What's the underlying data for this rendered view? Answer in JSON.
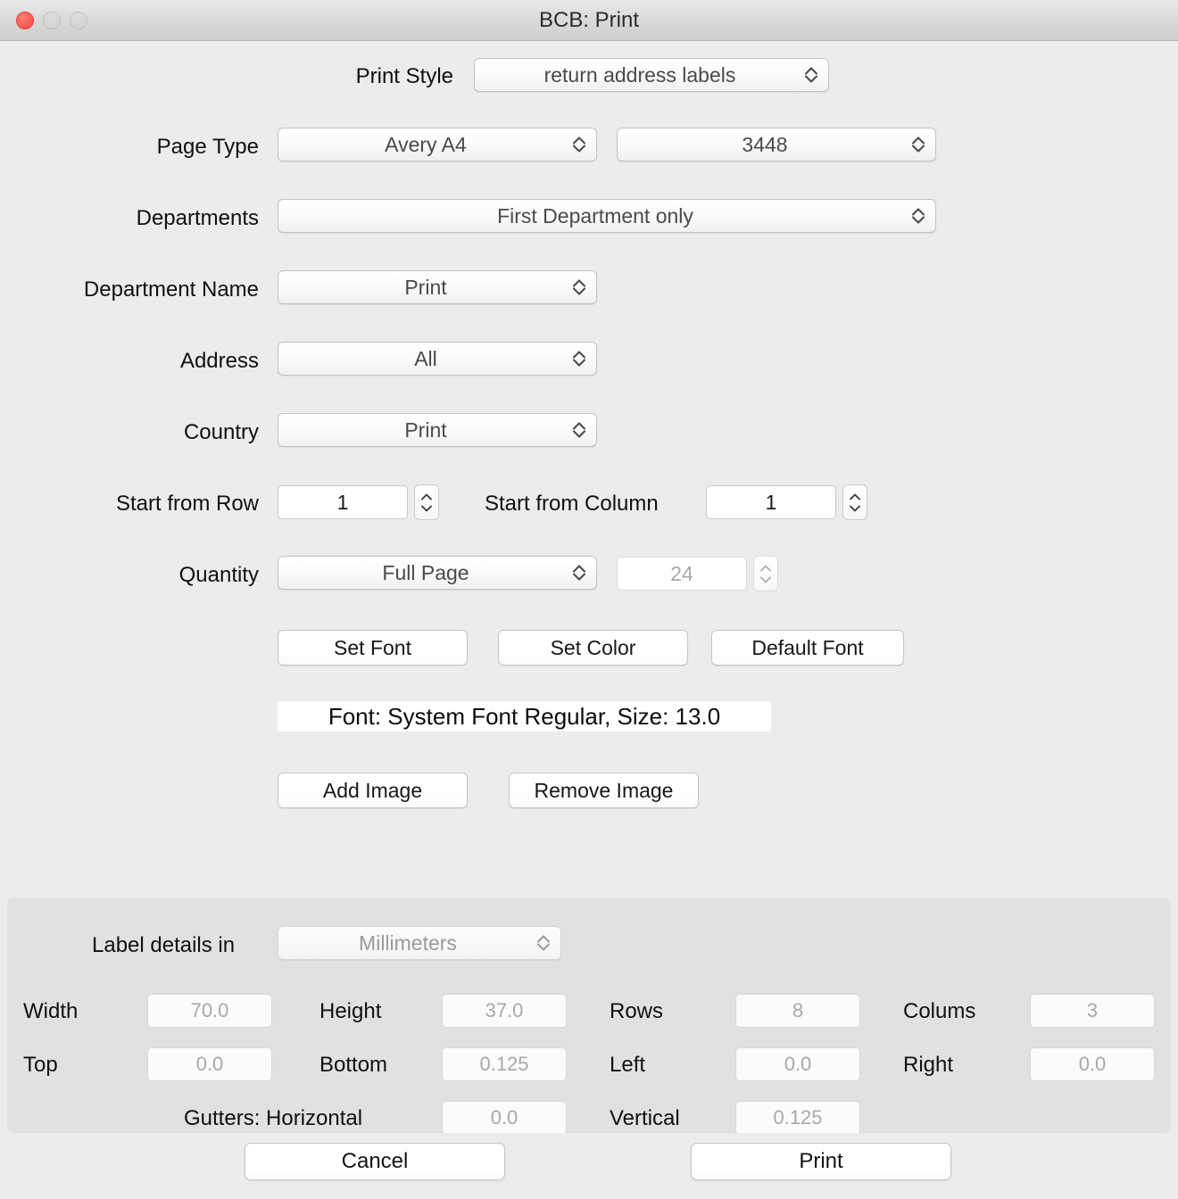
{
  "window": {
    "title": "BCB: Print",
    "close_label": "close",
    "minimize_label": "minimize",
    "zoom_label": "zoom"
  },
  "form": {
    "print_style": {
      "label": "Print Style",
      "value": "return address labels"
    },
    "page_type": {
      "label": "Page Type",
      "brand_value": "Avery A4",
      "code_value": "3448"
    },
    "departments": {
      "label": "Departments",
      "value": "First Department only"
    },
    "department_name": {
      "label": "Department Name",
      "value": "Print"
    },
    "address": {
      "label": "Address",
      "value": "All"
    },
    "country": {
      "label": "Country",
      "value": "Print"
    },
    "start_from_row": {
      "label": "Start from Row",
      "value": "1"
    },
    "start_from_column": {
      "label": "Start from Column",
      "value": "1"
    },
    "quantity": {
      "label": "Quantity",
      "mode_value": "Full Page",
      "count_value": "24"
    }
  },
  "font_controls": {
    "set_font": "Set Font",
    "set_color": "Set Color",
    "default_font": "Default Font",
    "status": "Font: System Font Regular, Size: 13.0"
  },
  "image_controls": {
    "add_image": "Add Image",
    "remove_image": "Remove Image"
  },
  "label_details": {
    "units_label": "Label details in",
    "units_value": "Millimeters",
    "width_label": "Width",
    "width_value": "70.0",
    "height_label": "Height",
    "height_value": "37.0",
    "rows_label": "Rows",
    "rows_value": "8",
    "columns_label": "Colums",
    "columns_value": "3",
    "top_label": "Top",
    "top_value": "0.0",
    "bottom_label": "Bottom",
    "bottom_value": "0.125",
    "left_label": "Left",
    "left_value": "0.0",
    "right_label": "Right",
    "right_value": "0.0",
    "gutters_horizontal_label": "Gutters: Horizontal",
    "gutters_horizontal_value": "0.0",
    "gutters_vertical_label": "Vertical",
    "gutters_vertical_value": "0.125"
  },
  "footer": {
    "cancel": "Cancel",
    "print": "Print"
  },
  "colors": {
    "window_background": "#ececec",
    "panel_background": "#e1e1e1",
    "close_button": "#f9564c",
    "text": "#101010",
    "disabled_text": "#a8a8a8"
  }
}
